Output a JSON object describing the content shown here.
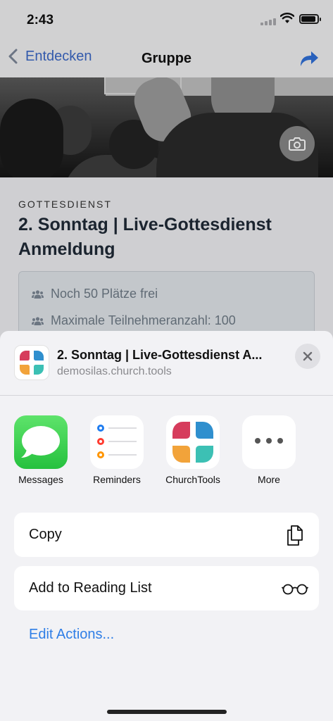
{
  "status_bar": {
    "time": "2:43"
  },
  "nav": {
    "back_label": "Entdecken",
    "title": "Gruppe"
  },
  "group": {
    "category": "GOTTESDIENST",
    "title": "2. Sonntag | Live-Gottesdienst Anmeldung",
    "info": [
      {
        "icon": "users-icon",
        "text": "Noch 50 Plätze frei"
      },
      {
        "icon": "users-icon",
        "text": "Maximale Teilnehmeranzahl: 100"
      }
    ]
  },
  "share_sheet": {
    "title": "2. Sonntag | Live-Gottesdienst A...",
    "subtitle": "demosilas.church.tools",
    "apps": [
      {
        "label": "Messages",
        "icon": "messages-icon"
      },
      {
        "label": "Reminders",
        "icon": "reminders-icon"
      },
      {
        "label": "ChurchTools",
        "icon": "churchtools-icon"
      },
      {
        "label": "More",
        "icon": "more-icon"
      }
    ],
    "actions": [
      {
        "label": "Copy",
        "icon": "copy-icon"
      },
      {
        "label": "Add to Reading List",
        "icon": "glasses-icon"
      }
    ],
    "edit_actions_label": "Edit Actions..."
  },
  "colors": {
    "accent": "#2f7ee6",
    "nav_tint": "#3b67c4",
    "messages_green": "#34c759",
    "churchtools_red": "#d63c5c",
    "churchtools_blue": "#2f8fce",
    "churchtools_orange": "#f2a33a",
    "churchtools_teal": "#3cc0b4"
  }
}
